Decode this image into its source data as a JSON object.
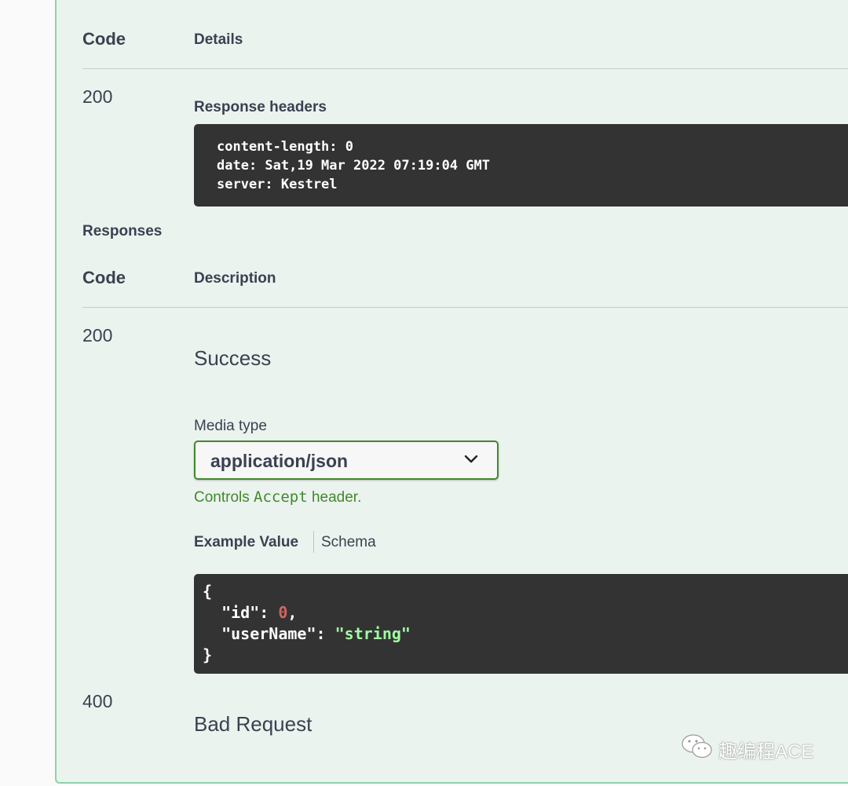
{
  "server_response": {
    "col_code": "Code",
    "col_details": "Details",
    "code": "200",
    "headers_label": "Response headers",
    "header_lines": [
      "content-length: 0",
      "date: Sat,19 Mar 2022 07:19:04 GMT",
      "server: Kestrel"
    ]
  },
  "responses": {
    "title": "Responses",
    "col_code": "Code",
    "col_description": "Description",
    "items": [
      {
        "code": "200",
        "description": "Success",
        "media_type_label": "Media type",
        "media_type_value": "application/json",
        "controls_note_prefix": "Controls ",
        "controls_note_code": "Accept",
        "controls_note_suffix": " header.",
        "tabs": [
          "Example Value",
          "Schema"
        ],
        "example_json": {
          "open": "{",
          "id_key": "\"id\"",
          "id_value": "0",
          "username_key": "\"userName\"",
          "username_value": "\"string\"",
          "close": "}"
        }
      },
      {
        "code": "400",
        "description": "Bad Request"
      }
    ]
  },
  "watermark": {
    "text": "趣编程ACE",
    "icon": "wechat-icon"
  },
  "colors": {
    "panel_bg": "#ebf3ee",
    "panel_border": "#8fd3a9",
    "accent_green": "#41892c",
    "code_bg": "#333333",
    "json_number": "#d36363",
    "json_string": "#a2fca2"
  }
}
